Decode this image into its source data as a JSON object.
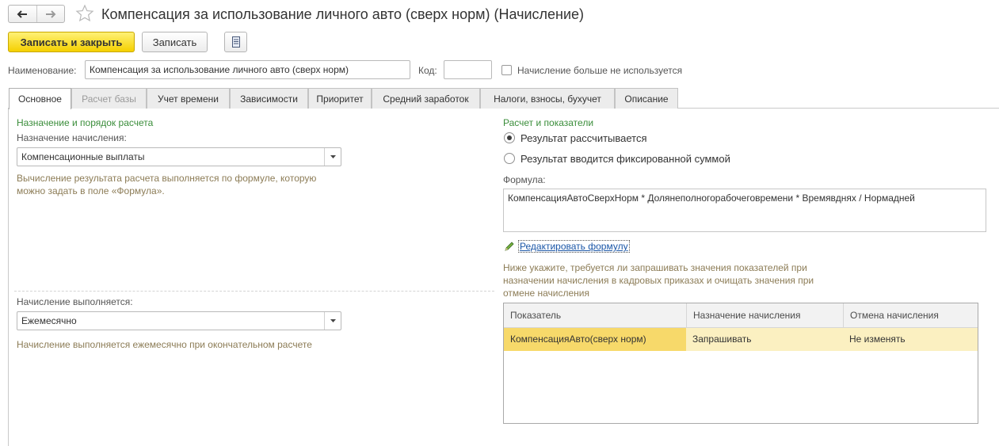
{
  "window": {
    "title": "Компенсация за использование личного авто (сверх норм) (Начисление)"
  },
  "toolbar": {
    "save_close_label": "Записать и закрыть",
    "save_label": "Записать"
  },
  "header": {
    "name_label": "Наименование:",
    "name_value": "Компенсация за использование личного авто (сверх норм)",
    "code_label": "Код:",
    "code_value": "",
    "not_used_label": "Начисление больше не используется",
    "not_used_checked": false
  },
  "tabs": [
    {
      "label": "Основное",
      "active": true
    },
    {
      "label": "Расчет базы",
      "disabled": true
    },
    {
      "label": "Учет времени"
    },
    {
      "label": "Зависимости"
    },
    {
      "label": "Приоритет"
    },
    {
      "label": "Средний заработок"
    },
    {
      "label": "Налоги, взносы, бухучет"
    },
    {
      "label": "Описание"
    }
  ],
  "left": {
    "section_title": "Назначение и порядок расчета",
    "purpose_label": "Назначение начисления:",
    "purpose_value": "Компенсационные выплаты",
    "purpose_hint": "Вычисление результата расчета выполняется по формуле, которую можно задать в поле «Формула».",
    "performed_label": "Начисление выполняется:",
    "performed_value": "Ежемесячно",
    "performed_hint": "Начисление выполняется ежемесячно при окончательном расчете"
  },
  "right": {
    "section_title": "Расчет и показатели",
    "radio_calculated": "Результат рассчитывается",
    "radio_fixed": "Результат вводится фиксированной суммой",
    "formula_label": "Формула:",
    "formula_value": "КомпенсацияАвтоСверхНорм * Долянеполногорабочеговремени * Времявднях / Нормадней",
    "edit_formula_link": "Редактировать формулу",
    "indicators_hint": "Ниже укажите, требуется ли запрашивать значения показателей при назначении начисления в кадровых приказах и очищать значения при отмене начисления",
    "table": {
      "columns": [
        "Показатель",
        "Назначение начисления",
        "Отмена начисления"
      ],
      "rows": [
        [
          "КомпенсацияАвто(сверх норм)",
          "Запрашивать",
          "Не изменять"
        ]
      ]
    }
  },
  "colors": {
    "accent_yellow": "#f5d000",
    "section_green": "#3a8d3a",
    "hint_brown": "#8c7c56",
    "row_highlight": "#fbf0c1",
    "link_blue": "#1a56a7"
  }
}
